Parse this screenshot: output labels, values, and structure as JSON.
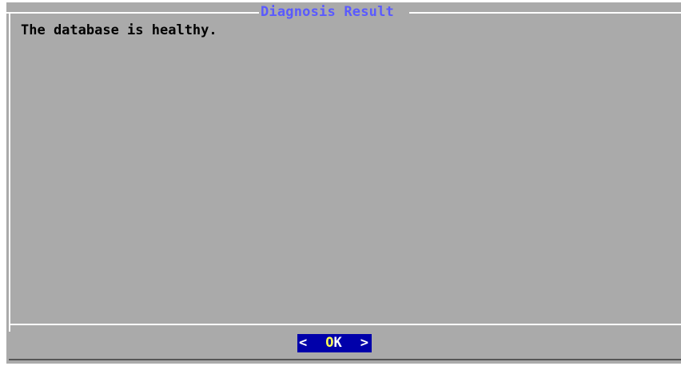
{
  "dialog": {
    "title": "Diagnosis Result",
    "message": "The database is healthy.",
    "ok_button": {
      "left_bracket": "<",
      "label_first": "O",
      "label_rest": "K",
      "right_bracket": ">"
    }
  },
  "colors": {
    "dialog_background": "#aaaaaa",
    "title_text": "#5a5aff",
    "button_background": "#0000aa",
    "button_hotkey": "#ffff55",
    "frame": "#ffffff"
  }
}
